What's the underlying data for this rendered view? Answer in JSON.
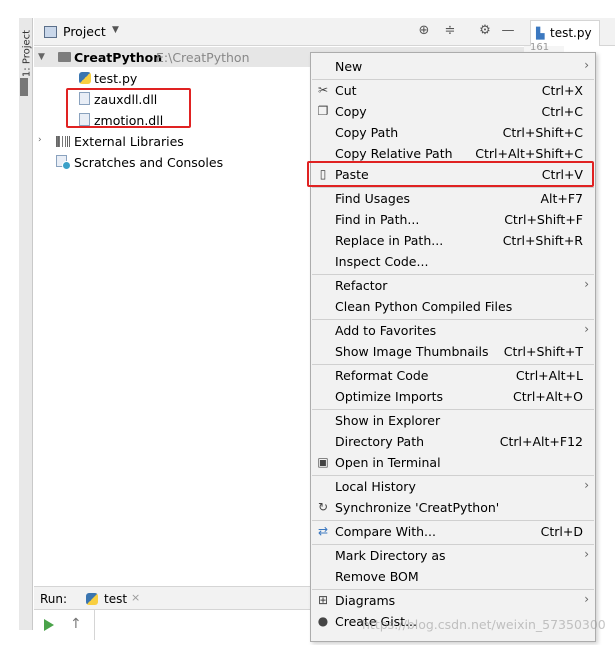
{
  "side_tab": {
    "label": "1: Project"
  },
  "header": {
    "title": "Project"
  },
  "editor": {
    "tab_label": "test.py",
    "line_number": "161"
  },
  "tree": {
    "root_name": "CreatPython",
    "root_path": "E:\\CreatPython",
    "files": [
      "test.py",
      "zauxdll.dll",
      "zmotion.dll"
    ],
    "external_libraries": "External Libraries",
    "scratches": "Scratches and Consoles"
  },
  "run": {
    "label": "Run:",
    "tab": "test"
  },
  "menu": {
    "items": [
      {
        "label": "New",
        "shortcut": "",
        "submenu": true,
        "icon": ""
      },
      {
        "label": "Cut",
        "shortcut": "Ctrl+X",
        "submenu": false,
        "icon": "scissors-icon"
      },
      {
        "label": "Copy",
        "shortcut": "Ctrl+C",
        "submenu": false,
        "icon": "copy-icon"
      },
      {
        "label": "Copy Path",
        "shortcut": "Ctrl+Shift+C",
        "submenu": false,
        "icon": ""
      },
      {
        "label": "Copy Relative Path",
        "shortcut": "Ctrl+Alt+Shift+C",
        "submenu": false,
        "icon": ""
      },
      {
        "label": "Paste",
        "shortcut": "Ctrl+V",
        "submenu": false,
        "icon": "clipboard-icon"
      },
      {
        "label": "Find Usages",
        "shortcut": "Alt+F7",
        "submenu": false,
        "icon": ""
      },
      {
        "label": "Find in Path...",
        "shortcut": "Ctrl+Shift+F",
        "submenu": false,
        "icon": ""
      },
      {
        "label": "Replace in Path...",
        "shortcut": "Ctrl+Shift+R",
        "submenu": false,
        "icon": ""
      },
      {
        "label": "Inspect Code...",
        "shortcut": "",
        "submenu": false,
        "icon": ""
      },
      {
        "label": "Refactor",
        "shortcut": "",
        "submenu": true,
        "icon": ""
      },
      {
        "label": "Clean Python Compiled Files",
        "shortcut": "",
        "submenu": false,
        "icon": ""
      },
      {
        "label": "Add to Favorites",
        "shortcut": "",
        "submenu": true,
        "icon": ""
      },
      {
        "label": "Show Image Thumbnails",
        "shortcut": "Ctrl+Shift+T",
        "submenu": false,
        "icon": ""
      },
      {
        "label": "Reformat Code",
        "shortcut": "Ctrl+Alt+L",
        "submenu": false,
        "icon": ""
      },
      {
        "label": "Optimize Imports",
        "shortcut": "Ctrl+Alt+O",
        "submenu": false,
        "icon": ""
      },
      {
        "label": "Show in Explorer",
        "shortcut": "",
        "submenu": false,
        "icon": ""
      },
      {
        "label": "Directory Path",
        "shortcut": "Ctrl+Alt+F12",
        "submenu": false,
        "icon": ""
      },
      {
        "label": "Open in Terminal",
        "shortcut": "",
        "submenu": false,
        "icon": "terminal-icon"
      },
      {
        "label": "Local History",
        "shortcut": "",
        "submenu": true,
        "icon": ""
      },
      {
        "label": "Synchronize 'CreatPython'",
        "shortcut": "",
        "submenu": false,
        "icon": "sync-icon"
      },
      {
        "label": "Compare With...",
        "shortcut": "Ctrl+D",
        "submenu": false,
        "icon": "compare-icon"
      },
      {
        "label": "Mark Directory as",
        "shortcut": "",
        "submenu": true,
        "icon": ""
      },
      {
        "label": "Remove BOM",
        "shortcut": "",
        "submenu": false,
        "icon": ""
      },
      {
        "label": "Diagrams",
        "shortcut": "",
        "submenu": true,
        "icon": "diagram-icon"
      },
      {
        "label": "Create Gist...",
        "shortcut": "",
        "submenu": false,
        "icon": "github-icon"
      }
    ]
  },
  "watermark": "https://blog.csdn.net/weixin_57350300",
  "colors": {
    "highlight_border": "#e02222",
    "menu_bg": "#f2f2f2",
    "root_row_bg": "#e6e6e6"
  }
}
